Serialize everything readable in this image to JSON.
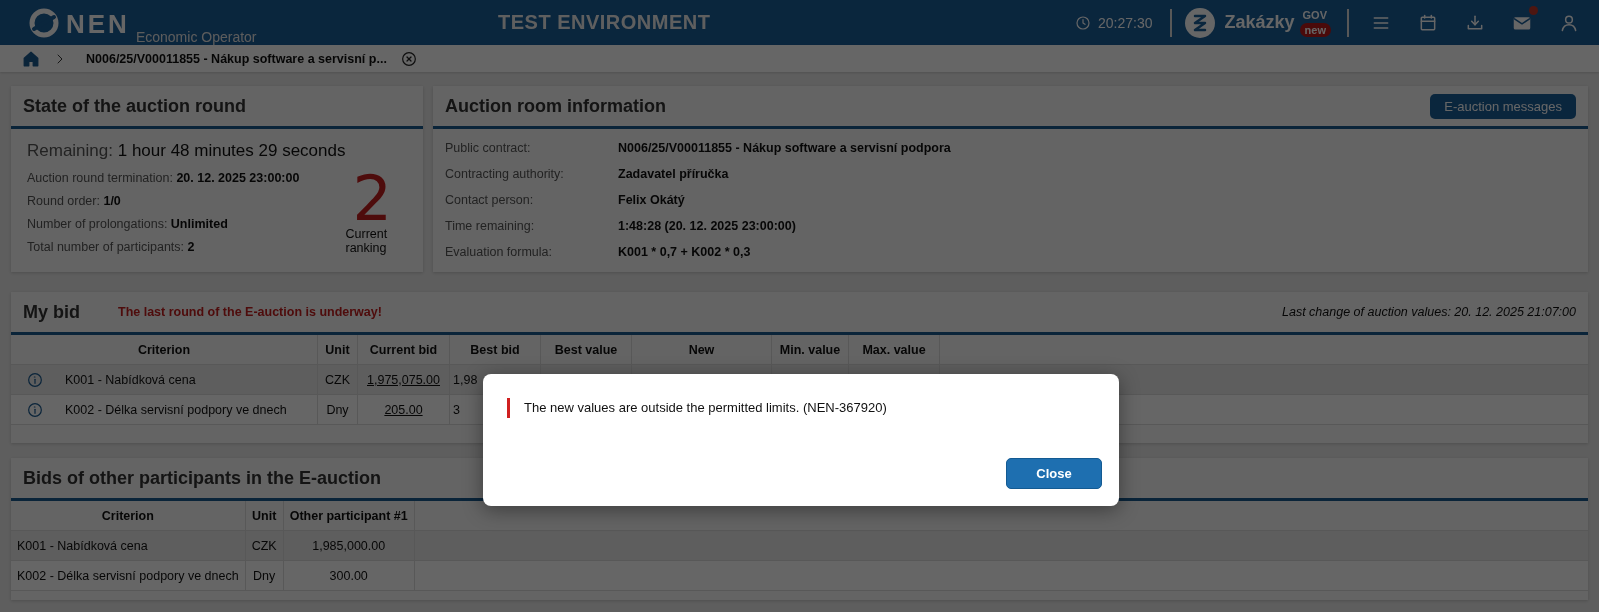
{
  "header": {
    "logo": "NEN",
    "subtitle": "Economic Operator",
    "environment": "TEST ENVIRONMENT",
    "clock": "20:27:30",
    "brand": "Zakázky",
    "brand_sup": "GOV",
    "brand_badge": "new",
    "mail_notification": true
  },
  "breadcrumb": {
    "current": "N006/25/V00011855 - Nákup software a servisní p..."
  },
  "round_state": {
    "title": "State of the auction round",
    "remaining_label": "Remaining:",
    "remaining_value": "1 hour 48 minutes 29 seconds",
    "fields": [
      {
        "label": "Auction round termination:",
        "value": "20. 12. 2025 23:00:00"
      },
      {
        "label": "Round order:",
        "value": "1/0"
      },
      {
        "label": "Number of prolongations:",
        "value": "Unlimited"
      },
      {
        "label": "Total number of participants:",
        "value": "2"
      }
    ],
    "ranking": "2",
    "ranking_label": "Current ranking"
  },
  "room_info": {
    "title": "Auction room information",
    "button": "E-auction messages",
    "fields": [
      {
        "label": "Public contract:",
        "value": "N006/25/V00011855 - Nákup software a servisní podpora"
      },
      {
        "label": "Contracting authority:",
        "value": "Zadavatel příručka"
      },
      {
        "label": "Contact person:",
        "value": "Felix Okátý"
      },
      {
        "label": "Time remaining:",
        "value": "1:48:28 (20. 12. 2025 23:00:00)"
      },
      {
        "label": "Evaluation formula:",
        "value": "K001 * 0,7 + K002 * 0,3"
      }
    ]
  },
  "my_bid": {
    "title": "My bid",
    "alert": "The last round of the E-auction is underway!",
    "last_change": "Last change of auction values: 20. 12. 2025 21:07:00",
    "columns": [
      "Criterion",
      "Unit",
      "Current bid",
      "Best bid",
      "Best value",
      "New",
      "Min. value",
      "Max. value"
    ],
    "rows": [
      {
        "criterion": "K001 - Nabídková cena",
        "unit": "CZK",
        "current_bid": "1,975,075.00",
        "best_bid": "1,98"
      },
      {
        "criterion": "K002 - Délka servisní podpory ve dnech",
        "unit": "Dny",
        "current_bid": "205.00",
        "best_bid": "3"
      }
    ]
  },
  "other_bids": {
    "title": "Bids of other participants in the E-auction",
    "columns": [
      "Criterion",
      "Unit",
      "Other participant #1"
    ],
    "rows": [
      [
        "K001 - Nabídková cena",
        "CZK",
        "1,985,000.00"
      ],
      [
        "K002 - Délka servisní podpory ve dnech",
        "Dny",
        "300.00"
      ]
    ]
  },
  "dialog": {
    "message": "The new values are outside the permitted limits. (NEN-367920)",
    "button": "Close"
  }
}
